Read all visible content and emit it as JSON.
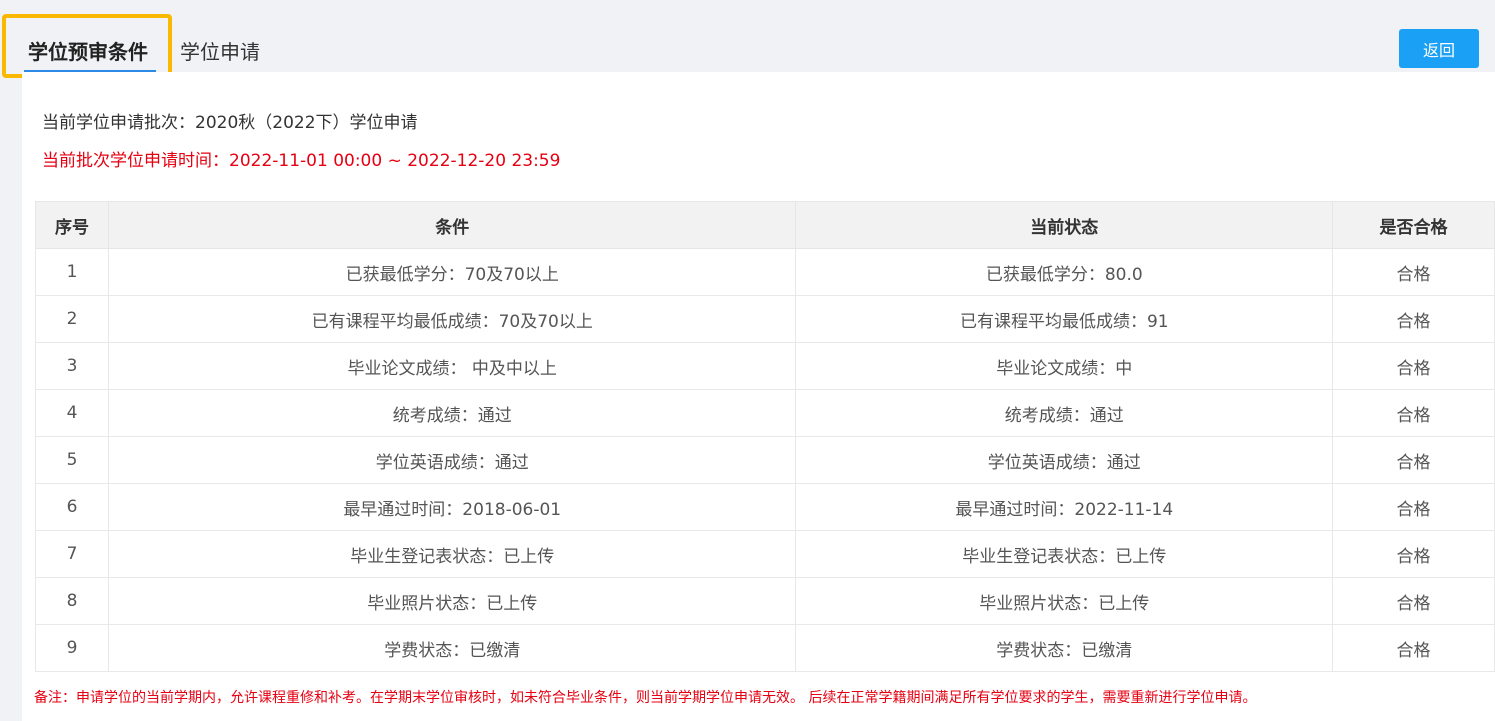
{
  "tabs": {
    "active": "学位预审条件",
    "second": "学位申请"
  },
  "back_button": "返回",
  "batch_text": "当前学位申请批次：2020秋（2022下）学位申请",
  "time_text": "当前批次学位申请时间：2022-11-01 00:00 ~ 2022-12-20 23:59",
  "table": {
    "headers": [
      "序号",
      "条件",
      "当前状态",
      "是否合格"
    ],
    "rows": [
      {
        "no": "1",
        "condition": "已获最低学分：70及70以上",
        "status": "已获最低学分：80.0",
        "result": "合格"
      },
      {
        "no": "2",
        "condition": "已有课程平均最低成绩：70及70以上",
        "status": "已有课程平均最低成绩：91",
        "result": "合格"
      },
      {
        "no": "3",
        "condition": "毕业论文成绩： 中及中以上",
        "status": "毕业论文成绩：中",
        "result": "合格"
      },
      {
        "no": "4",
        "condition": "统考成绩：通过",
        "status": "统考成绩：通过",
        "result": "合格"
      },
      {
        "no": "5",
        "condition": "学位英语成绩：通过",
        "status": "学位英语成绩：通过",
        "result": "合格"
      },
      {
        "no": "6",
        "condition": "最早通过时间：2018-06-01",
        "status": "最早通过时间：2022-11-14",
        "result": "合格"
      },
      {
        "no": "7",
        "condition": "毕业生登记表状态：已上传",
        "status": "毕业生登记表状态：已上传",
        "result": "合格"
      },
      {
        "no": "8",
        "condition": "毕业照片状态：已上传",
        "status": "毕业照片状态：已上传",
        "result": "合格"
      },
      {
        "no": "9",
        "condition": "学费状态：已缴清",
        "status": "学费状态：已缴清",
        "result": "合格"
      }
    ]
  },
  "note": "备注：申请学位的当前学期内，允许课程重修和补考。在学期末学位审核时，如未符合毕业条件，则当前学期学位申请无效。 后续在正常学籍期间满足所有学位要求的学生，需要重新进行学位申请。",
  "colors": {
    "accent": "#1aa0f4",
    "highlight": "#f9b900",
    "warning": "#e60012"
  }
}
